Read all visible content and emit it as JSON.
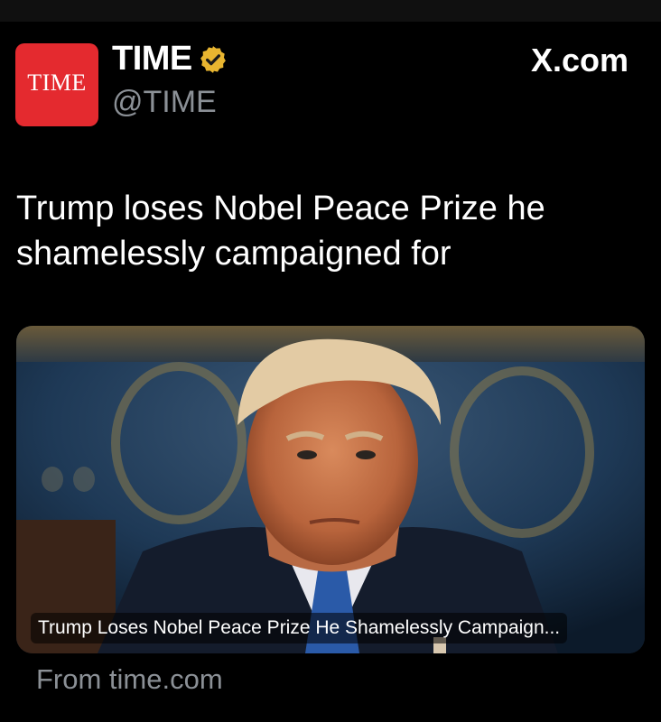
{
  "post": {
    "avatar_text": "TIME",
    "display_name": "TIME",
    "handle": "@TIME",
    "source_site": "X.com",
    "headline": "Trump loses Nobel Peace Prize he shamelessly campaigned for"
  },
  "link_card": {
    "image_alt": "Photo of Donald Trump seated, looking at the camera",
    "caption": "Trump Loses Nobel Peace Prize He Shamelessly Campaign...",
    "domain_label": "From time.com"
  },
  "colors": {
    "background": "#000000",
    "avatar_red": "#e42a2f",
    "verified_gold": "#e8b530",
    "secondary_text": "#8b9096"
  },
  "icons": {
    "verified": "verified-badge-icon"
  }
}
